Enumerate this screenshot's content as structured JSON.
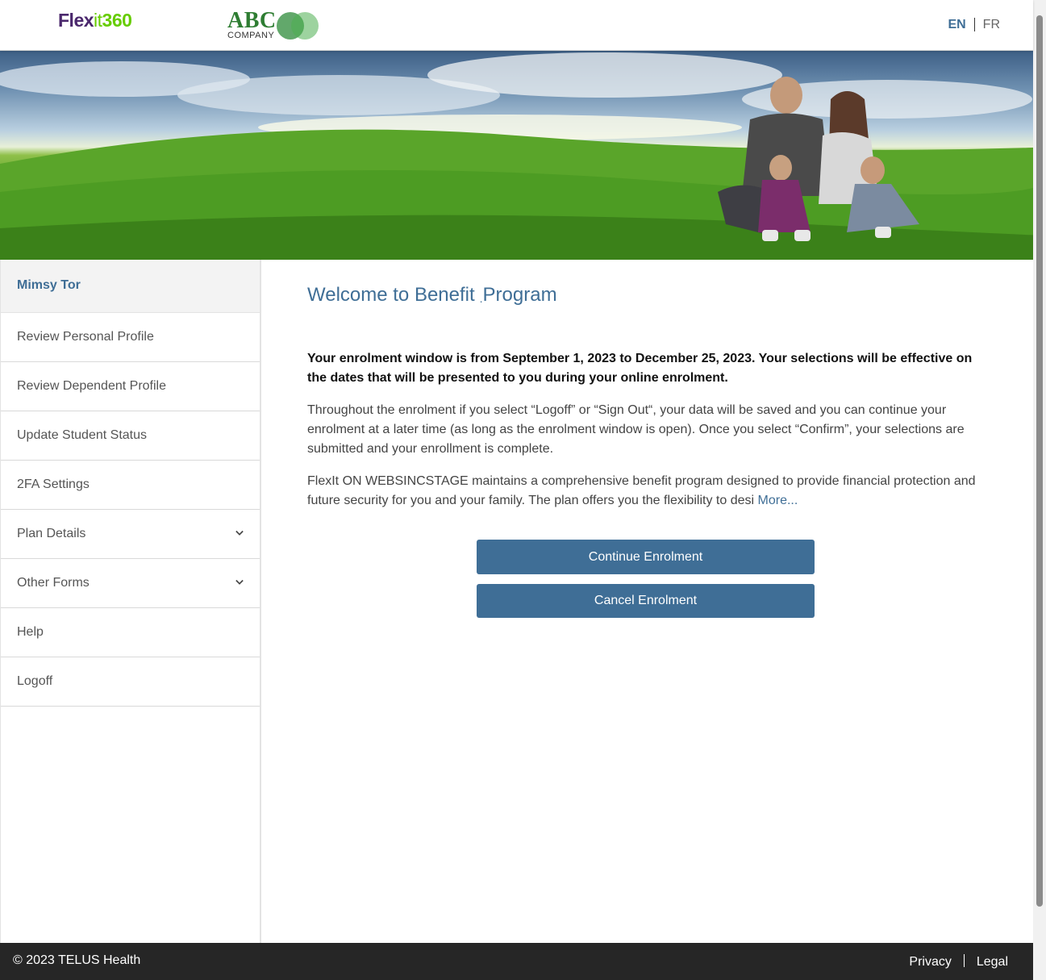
{
  "header": {
    "flexit_logo": {
      "part1": "Flex",
      "part2": "it",
      "part3": "360"
    },
    "company_logo": {
      "name": "ABC",
      "sub": "COMPANY"
    },
    "languages": {
      "en": "EN",
      "fr": "FR",
      "active": "EN"
    }
  },
  "sidebar": {
    "user_name": "Mimsy Tor",
    "items": [
      {
        "label": "Review Personal Profile",
        "expandable": false
      },
      {
        "label": "Review Dependent Profile",
        "expandable": false
      },
      {
        "label": "Update Student Status",
        "expandable": false
      },
      {
        "label": "2FA Settings",
        "expandable": false
      },
      {
        "label": "Plan Details",
        "expandable": true
      },
      {
        "label": "Other Forms",
        "expandable": true
      },
      {
        "label": "Help",
        "expandable": false
      },
      {
        "label": "Logoff",
        "expandable": false
      }
    ]
  },
  "main": {
    "title": "Welcome to Benefit",
    "title_dot": ".",
    "title_tail": "Program",
    "enrolment_notice": "Your enrolment window is from September 1, 2023 to December 25, 2023. Your selections will be effective on the dates that will be presented to you during your online enrolment.",
    "info_paragraph": "Throughout the enrolment if you select “Logoff” or “Sign Out“, your data will be saved and you can continue your enrolment at a later time (as long as the enrolment window is open). Once you select “Confirm”, your selections are submitted and your enrollment is complete.",
    "description": "FlexIt ON WEBSINCSTAGE maintains a comprehensive benefit program designed to provide financial protection and future security for you and your family.  The plan offers you the flexibility to desi",
    "more_link": "More...",
    "continue_button": "Continue Enrolment",
    "cancel_button": "Cancel Enrolment"
  },
  "footer": {
    "copyright": "© 2023 TELUS Health",
    "privacy": "Privacy",
    "legal": "Legal"
  },
  "colors": {
    "primary": "#3f6e96",
    "footer_bg": "#262626",
    "flexit_purple": "#4b286d",
    "flexit_green": "#66cc00"
  }
}
